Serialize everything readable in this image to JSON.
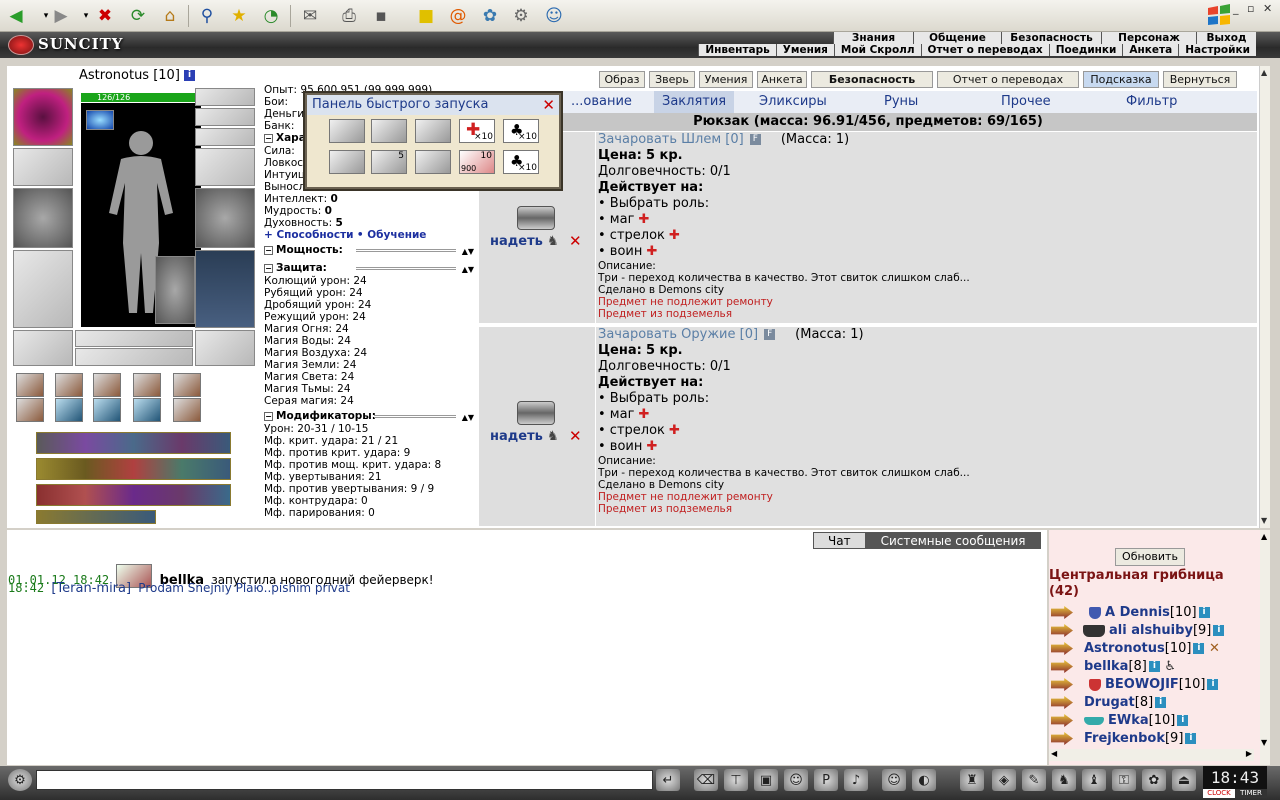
{
  "browser": {
    "icons": [
      "back-icon",
      "forward-icon",
      "stop-icon",
      "refresh-icon",
      "home-icon",
      "search-icon",
      "favorites-icon",
      "history-icon",
      "mail-icon",
      "print-icon",
      "edit-icon",
      "notes-icon",
      "messenger-icon",
      "icq-icon",
      "tools-icon",
      "contacts-icon"
    ],
    "window_controls": [
      "_",
      "▫",
      "✕"
    ]
  },
  "header": {
    "logo": "SUNCITY",
    "menu_top": [
      "Знания",
      "Общение",
      "Безопасность",
      "Персонаж",
      "Выход"
    ],
    "menu_bottom": [
      "Инвентарь",
      "Умения",
      "Мой Скролл",
      "Отчет о переводах",
      "Поединки",
      "Анкета",
      "Настройки"
    ]
  },
  "character": {
    "name": "Astronotus",
    "level": "[10]",
    "hp": "126/126",
    "stats": [
      "Опыт: 95 600 951 (99 999 999)",
      "Бои:",
      "Деньги:",
      "Банк:"
    ],
    "char_section": "Характеристики:",
    "attributes": [
      {
        "label": "Сила:",
        "value": ""
      },
      {
        "label": "Ловкость:",
        "value": ""
      },
      {
        "label": "Интуиция:",
        "value": ""
      },
      {
        "label": "Выносливость:",
        "value": "10"
      },
      {
        "label": "Интеллект:",
        "value": "0"
      },
      {
        "label": "Мудрость:",
        "value": "0"
      },
      {
        "label": "Духовность:",
        "value": "5"
      }
    ],
    "abilities_link": "+ Способности",
    "training_link": "• Обучение",
    "power_section": "Мощность:",
    "defense_section": "Защита:",
    "defense": [
      "Колющий урон: 24",
      "Рубящий урон: 24",
      "Дробящий урон: 24",
      "Режущий урон: 24",
      "Магия Огня: 24",
      "Магия Воды: 24",
      "Магия Воздуха: 24",
      "Магия Земли: 24",
      "Магия Света: 24",
      "Магия Тьмы: 24",
      "Серая магия: 24"
    ],
    "modifiers_section": "Модификаторы:",
    "modifiers": [
      "Урон: 20-31 / 10-15",
      "Мф. крит. удара: 21 / 21",
      "Мф. против крит. удара: 9",
      "Мф. против мощ. крит. удара: 8",
      "Мф. увертывания: 21",
      "Мф. против увертывания: 9 / 9",
      "Мф. контрудара: 0",
      "Мф. парирования: 0"
    ]
  },
  "top_buttons": [
    "Образ",
    "Зверь",
    "Умения",
    "Анкета",
    "Безопасность",
    "Отчет о переводах",
    "Подсказка",
    "Вернуться"
  ],
  "tabs": [
    "...ование",
    "Заклятия",
    "Эликсиры",
    "Руны",
    "Прочее",
    "Фильтр"
  ],
  "backpack": "Рюкзак (масса: 96.91/456, предметов: 69/165)",
  "items": [
    {
      "title": "Зачаровать Шлем [0]",
      "f": "F",
      "mass": "(Масса: 1)",
      "price_label": "Цена:",
      "price": "5 кр.",
      "durability": "Долговечность: 0/1",
      "acts_on": "Действует на:",
      "roles": [
        "• Выбрать роль:",
        "• маг",
        "• стрелок",
        "• воин"
      ],
      "desc_label": "Описание:",
      "desc": "Три - переход количества в качество. Этот свиток слишком слаб...",
      "made_in": "Сделано в Demons city",
      "warn1": "Предмет не подлежит ремонту",
      "warn2": "Предмет из подземелья",
      "wear": "надеть"
    },
    {
      "title": "Зачаровать Оружие [0]",
      "f": "F",
      "mass": "(Масса: 1)",
      "price_label": "Цена:",
      "price": "5 кр.",
      "durability": "Долговечность: 0/1",
      "acts_on": "Действует на:",
      "roles": [
        "• Выбрать роль:",
        "• маг",
        "• стрелок",
        "• воин"
      ],
      "desc_label": "Описание:",
      "desc": "Три - переход количества в качество. Этот свиток слишком слаб...",
      "made_in": "Сделано в Demons city",
      "warn1": "Предмет не подлежит ремонту",
      "warn2": "Предмет из подземелья",
      "wear": "надеть"
    }
  ],
  "quick_panel": {
    "title": "Панель быстрого запуска",
    "counts": [
      "×10",
      "×10",
      "5",
      "10",
      "×10"
    ],
    "extra": "900"
  },
  "chat": {
    "tabs": [
      "Чат",
      "Системные сообщения"
    ],
    "lines": [
      {
        "time": "01.01.12 18:42",
        "nick": "bellka",
        "msg": "запустила новогодний фейерверк!"
      },
      {
        "time": "18:42",
        "nick": "[Teran-mira]",
        "msg": "Prodam Snejniy Plaю..pishim privat"
      }
    ]
  },
  "userlist": {
    "refresh": "Обновить",
    "location": "Центральная грибница",
    "count": "(42)",
    "users": [
      {
        "name": "A Dennis",
        "level": "[10]"
      },
      {
        "name": "ali alshuiby",
        "level": "[9]"
      },
      {
        "name": "Astronotus",
        "level": "[10]"
      },
      {
        "name": "bellka",
        "level": "[8]"
      },
      {
        "name": "BEOWOJIF",
        "level": "[10]"
      },
      {
        "name": "Drugat",
        "level": "[8]"
      },
      {
        "name": "EWka",
        "level": "[10]"
      },
      {
        "name": "Frejkenbok",
        "level": "[9]"
      }
    ]
  },
  "bottom": {
    "clock": "18:43",
    "clock_label": "CLOCK",
    "timer_label": "TIMER"
  }
}
